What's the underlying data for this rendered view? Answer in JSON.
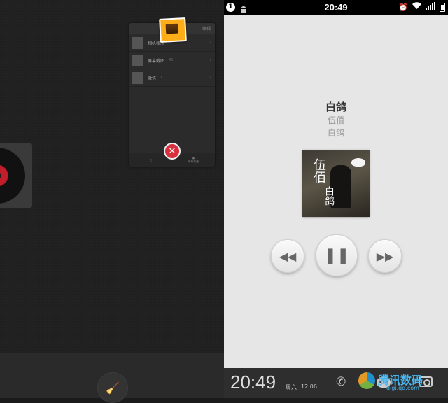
{
  "recent_apps": {
    "gallery_card": {
      "header_label": "编辑",
      "albums": [
        {
          "name": "相机相册",
          "count": "12"
        },
        {
          "name": "屏幕截图",
          "count": "40"
        },
        {
          "name": "微信",
          "count": "1"
        }
      ],
      "footer": [
        "",
        "所有相册"
      ]
    },
    "close_symbol": "✕",
    "clean_symbol": "🧹"
  },
  "status_bar": {
    "badge": "1",
    "time": "20:49"
  },
  "player": {
    "song_title": "白鸽",
    "artist": "伍佰",
    "album": "白鸽",
    "cover_text_1": "伍佰",
    "cover_text_2": "白鸽",
    "prev_symbol": "◀◀",
    "play_pause_symbol": "❚❚",
    "next_symbol": "▶▶"
  },
  "lock_bar": {
    "time": "20:49",
    "weekday": "周六",
    "date": "12.06"
  },
  "watermark": {
    "brand": "腾讯数码",
    "sub": "digi.qq.com"
  },
  "colors": {
    "close_red": "#d8313d",
    "lock_bg": "#e6e6e6",
    "dark_bg": "#202020"
  }
}
